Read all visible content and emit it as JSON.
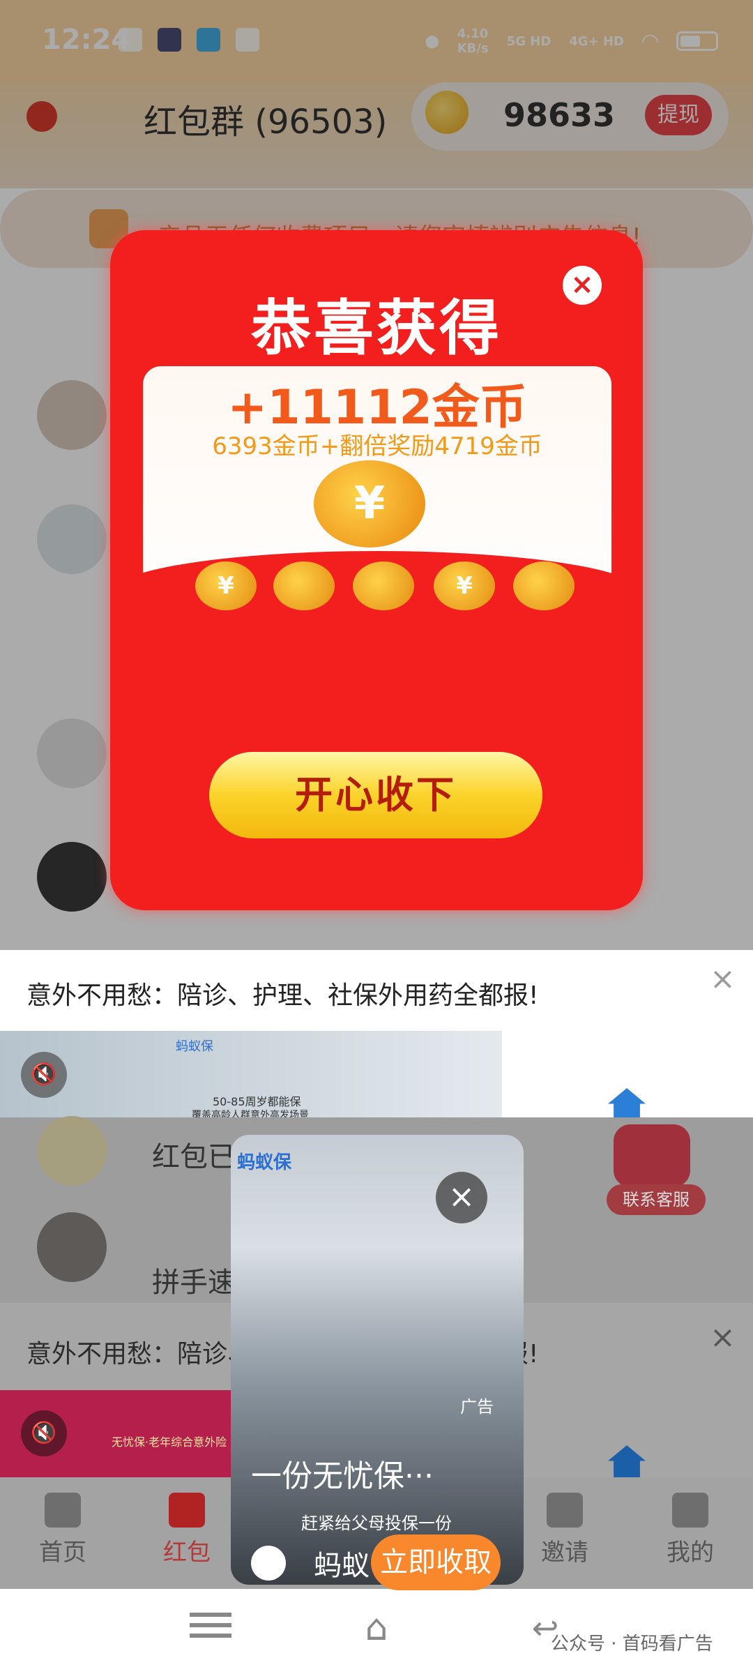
{
  "status_bar": {
    "time": "12:24",
    "network_speed": "4.10",
    "network_unit": "KB/s",
    "sim1": "5G HD",
    "sim2": "4G+ HD"
  },
  "header": {
    "title": "红包群 (96503)",
    "coins": "98633",
    "withdraw_label": "提现"
  },
  "notice": {
    "text": "产品无任何收费项目，请您审慎辨别广告信息!"
  },
  "chat": {
    "preview_1": "红包已",
    "preview_2": "拼手速"
  },
  "modal": {
    "title": "恭喜获得",
    "amount": "+11112金币",
    "detail": "6393金币+翻倍奖励4719金币",
    "coin_symbol": "¥",
    "accept_label": "开心收下",
    "close_symbol": "×"
  },
  "ad_banner": {
    "title": "意外不用愁：陪诊、护理、社保外用药全都报!",
    "close_symbol": "×",
    "video_text": "50-85周岁都能保",
    "video_subtext": "覆盖高龄人群意外高发场景",
    "brand_small": "蚂蚁保",
    "service_label": "联系客服"
  },
  "ad_banner_2": {
    "title": "意外不用愁：陪诊、护理、社保外用药全都报!",
    "close_symbol": "×",
    "video_text": "无忧保·老年综合意外险"
  },
  "float_ad": {
    "brand_top": "蚂蚁保",
    "ad_label": "广告",
    "caption": "一份无忧保···",
    "sub": "赶紧给父母投保一份",
    "brand": "蚂蚁",
    "cta": "立即收取",
    "close_symbol": "×"
  },
  "bottom_nav": {
    "items": [
      {
        "label": "首页",
        "icon": "home-icon"
      },
      {
        "label": "红包",
        "icon": "red-packet-icon"
      },
      {
        "label": "邀请",
        "icon": "invite-icon"
      },
      {
        "label": "我的",
        "icon": "profile-icon"
      }
    ]
  },
  "watermark": "公众号 · 首码看广告",
  "colors": {
    "modal_red": "#f31e1e",
    "gold": "#fbd32a",
    "accent_orange": "#f8882b",
    "withdraw_red": "#e9434a"
  }
}
